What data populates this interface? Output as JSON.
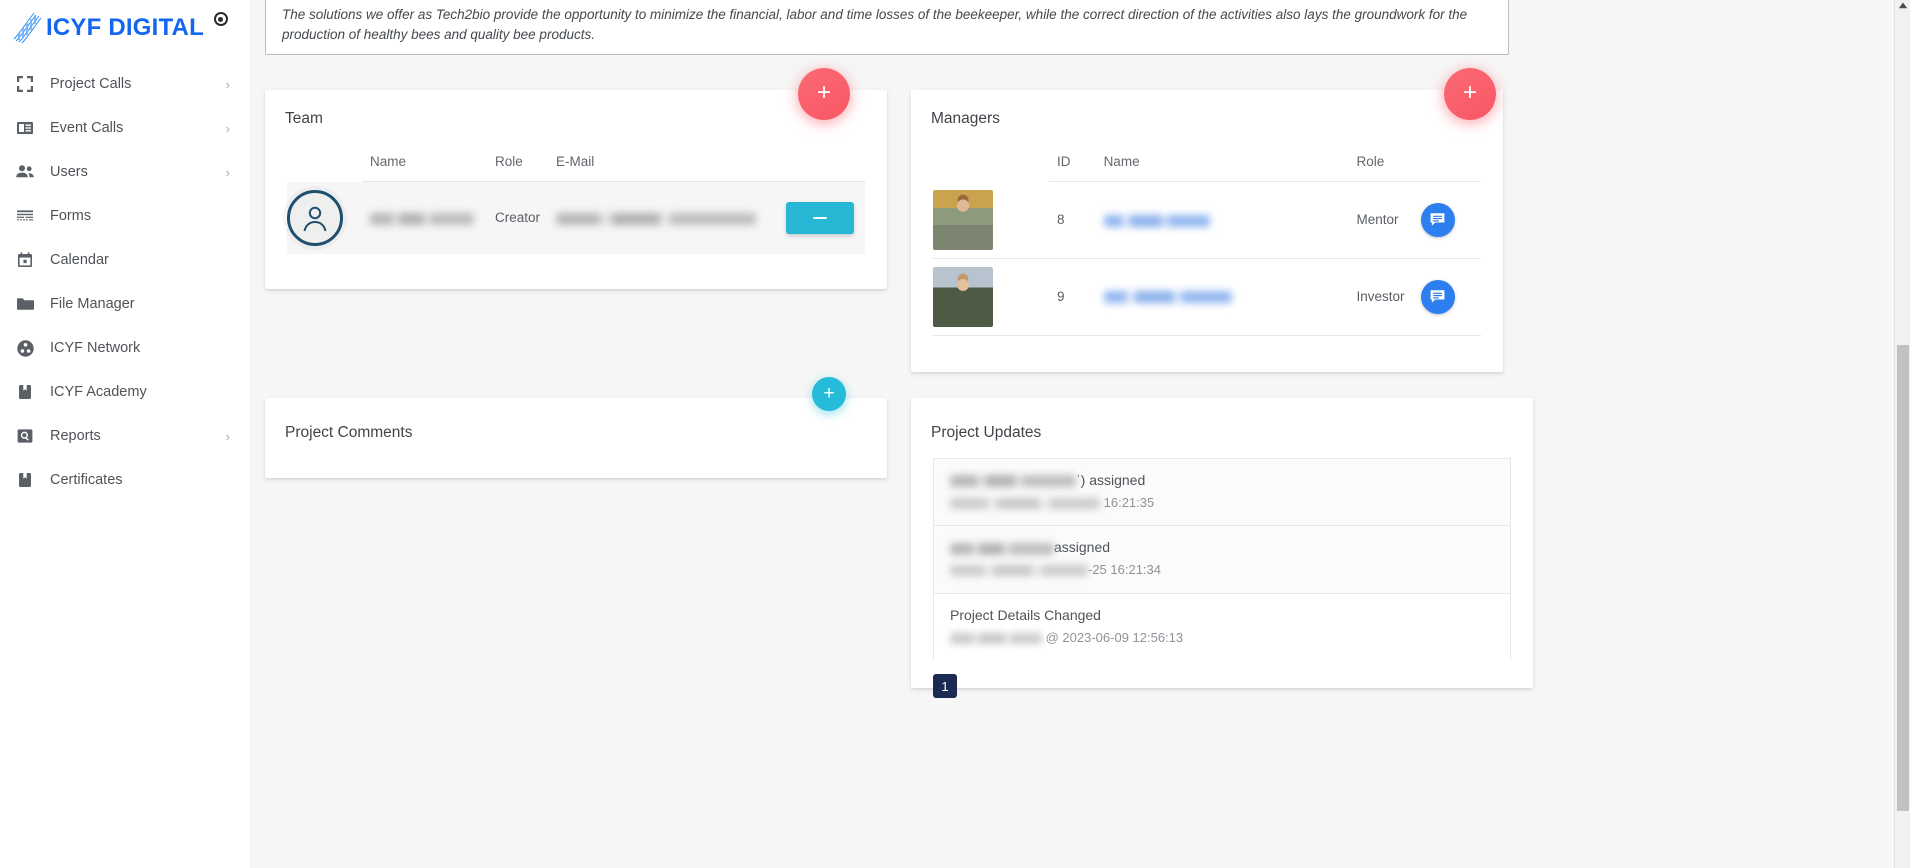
{
  "brand": {
    "name": "ICYF DIGITAL"
  },
  "sidebar": {
    "items": [
      {
        "label": "Project Calls",
        "icon": "expand-icon",
        "caret": "›"
      },
      {
        "label": "Event Calls",
        "icon": "article-icon",
        "caret": "›"
      },
      {
        "label": "Users",
        "icon": "people-icon",
        "caret": "›"
      },
      {
        "label": "Forms",
        "icon": "form-icon",
        "caret": ""
      },
      {
        "label": "Calendar",
        "icon": "calendar-icon",
        "caret": ""
      },
      {
        "label": "File Manager",
        "icon": "folder-icon",
        "caret": ""
      },
      {
        "label": "ICYF Network",
        "icon": "network-icon",
        "caret": ""
      },
      {
        "label": "ICYF Academy",
        "icon": "book-icon",
        "caret": ""
      },
      {
        "label": "Reports",
        "icon": "search-box-icon",
        "caret": "›"
      },
      {
        "label": "Certificates",
        "icon": "book-icon",
        "caret": ""
      }
    ]
  },
  "description": {
    "text": "The solutions we offer as Tech2bio provide the opportunity to minimize the financial, labor and time losses of the beekeeper, while the correct direction of the activities also lays the groundwork for the production of healthy bees and quality bee products."
  },
  "team": {
    "title": "Team",
    "add_label": "+",
    "columns": [
      "Name",
      "Role",
      "E-Mail"
    ],
    "rows": [
      {
        "name": "",
        "role": "Creator",
        "email": "",
        "action": "–"
      }
    ]
  },
  "managers": {
    "title": "Managers",
    "add_label": "+",
    "columns": [
      "ID",
      "Name",
      "Role"
    ],
    "rows": [
      {
        "id": "8",
        "name": "",
        "role": "Mentor",
        "action": "chat-icon"
      },
      {
        "id": "9",
        "name": "",
        "role": "Investor",
        "action": "chat-icon"
      }
    ]
  },
  "project_comments": {
    "title": "Project Comments",
    "add_label": "+"
  },
  "project_updates": {
    "title": "Project Updates",
    "items": [
      {
        "title_suffix": "ˈ) assigned",
        "meta_suffix": "16:21:35"
      },
      {
        "title_suffix": "assigned",
        "meta_suffix": "-25 16:21:34"
      },
      {
        "title_full": "Project Details Changed",
        "meta_suffix": "@ 2023-06-09 12:56:13"
      }
    ],
    "pagination": {
      "current": "1"
    }
  },
  "colors": {
    "brand_blue": "#1266f1",
    "fab_red": "#f85665",
    "fab_cyan": "#26bbd8",
    "minus_teal": "#27b7d4",
    "chat_blue": "#2d7ff0",
    "pager_navy": "#1b2a55"
  }
}
